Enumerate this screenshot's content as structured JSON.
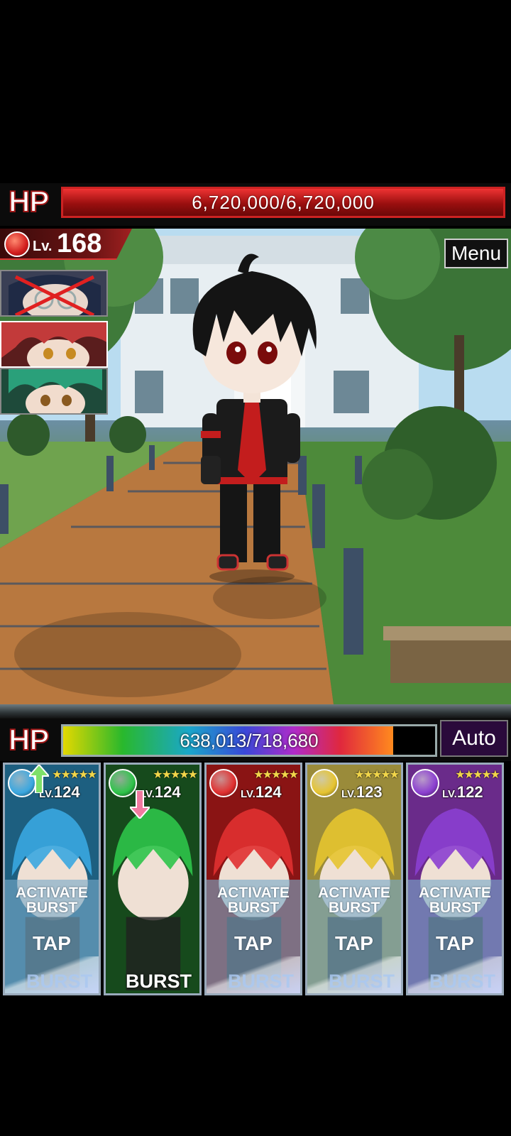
{
  "enemy": {
    "hp_label": "HP",
    "hp_text": "6,720,000/6,720,000",
    "hp_fraction": 1.0,
    "level_prefix": "Lv.",
    "level": "168",
    "element": "fire"
  },
  "menu_label": "Menu",
  "enemy_portraits": [
    {
      "name": "defeated-enemy",
      "status": "defeated"
    },
    {
      "name": "red-haired-enemy",
      "status": "current"
    },
    {
      "name": "green-haired-enemy",
      "status": "alive"
    }
  ],
  "player": {
    "hp_label": "HP",
    "hp_text": "638,013/718,680",
    "hp_fraction": 0.888
  },
  "auto_label": "Auto",
  "cards": [
    {
      "element": "water",
      "level_prefix": "LV.",
      "level": "124",
      "stars": "★★★★★",
      "status_arrow": "up",
      "activate": "ACTIVATE",
      "burst_word": "BURST",
      "tap": "TAP",
      "burst_label": "BURST",
      "ready": false,
      "bg": "#1d5f80",
      "orb": "#3aa7e0"
    },
    {
      "element": "wind",
      "level_prefix": "LV.",
      "level": "124",
      "stars": "★★★★★",
      "status_arrow": "down",
      "activate": "",
      "burst_word": "",
      "tap": "",
      "burst_label": "BURST",
      "ready": true,
      "bg": "#164a1c",
      "orb": "#2ec44a"
    },
    {
      "element": "fire",
      "level_prefix": "LV.",
      "level": "124",
      "stars": "★★★★★",
      "status_arrow": "",
      "activate": "ACTIVATE",
      "burst_word": "BURST",
      "tap": "TAP",
      "burst_label": "BURST",
      "ready": false,
      "bg": "#8a1414",
      "orb": "#e03030"
    },
    {
      "element": "light",
      "level_prefix": "LV.",
      "level": "123",
      "stars": "★★★★★",
      "status_arrow": "",
      "activate": "ACTIVATE",
      "burst_word": "BURST",
      "tap": "TAP",
      "burst_label": "BURST",
      "ready": false,
      "bg": "#9a8b3a",
      "orb": "#e6c430"
    },
    {
      "element": "dark",
      "level_prefix": "LV.",
      "level": "122",
      "stars": "★★★★★",
      "status_arrow": "",
      "activate": "ACTIVATE",
      "burst_word": "BURST",
      "tap": "TAP",
      "burst_label": "BURST",
      "ready": false,
      "bg": "#6a2b8a",
      "orb": "#8b3fd0"
    }
  ],
  "colors": {
    "enemy_hp": "#c42020",
    "accent_red": "#d33333",
    "star": "#f2d64a"
  }
}
